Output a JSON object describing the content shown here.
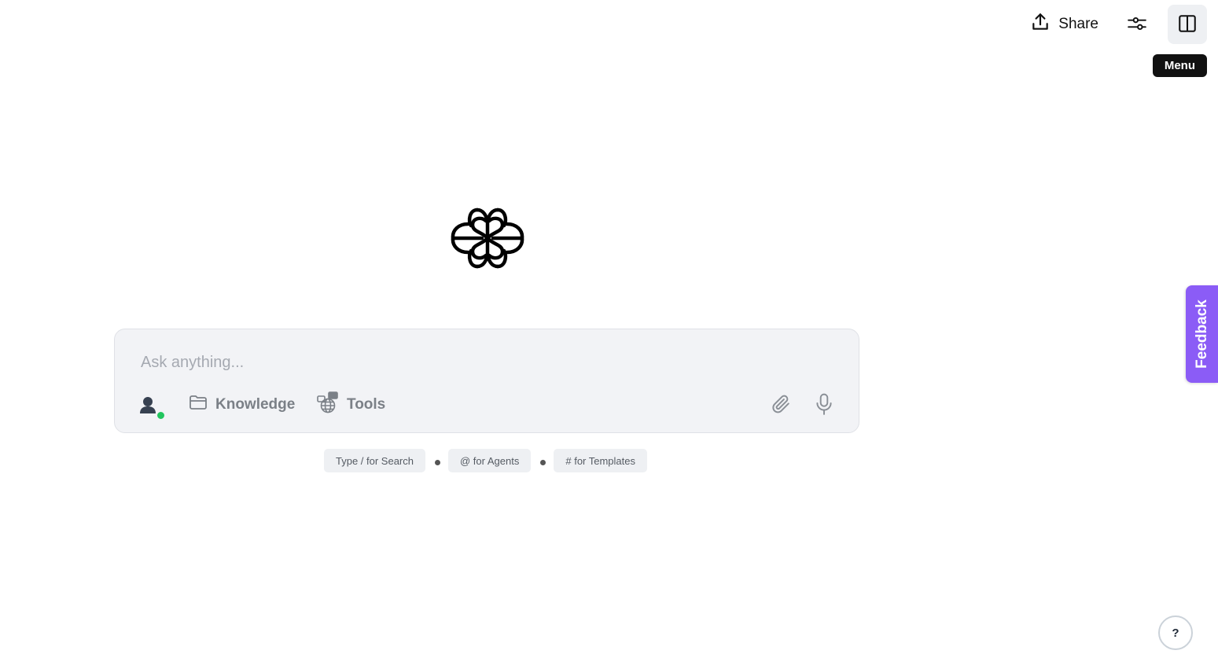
{
  "header": {
    "share_label": "Share",
    "tooltip": "Menu"
  },
  "composer": {
    "placeholder": "Ask anything...",
    "knowledge_label": "Knowledge",
    "tools_label": "Tools"
  },
  "hints": [
    "Type / for Search",
    "@ for Agents",
    "# for Templates"
  ],
  "feedback": {
    "label": "Feedback"
  },
  "help": {
    "label": "?"
  },
  "icons": {
    "logo": "brain-logo-icon",
    "share": "upload-icon",
    "settings": "sliders-icon",
    "menu": "sidebar-panel-icon",
    "avatar": "user-icon",
    "knowledge": "folder-icon",
    "tools": "globe-tools-icon",
    "attach": "paperclip-icon",
    "mic": "microphone-icon"
  },
  "colors": {
    "accent": "#8b5cf6",
    "status_online": "#22c55e",
    "composer_bg": "#f2f3f6",
    "tooltip_bg": "#111111"
  }
}
